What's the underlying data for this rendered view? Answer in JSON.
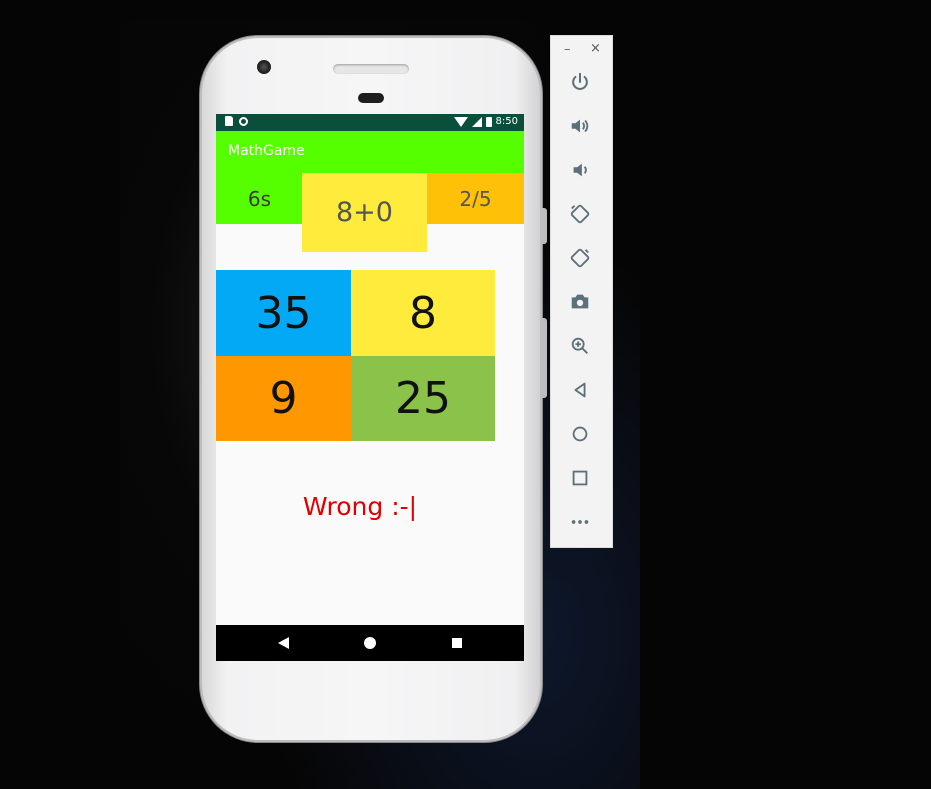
{
  "status_bar": {
    "time": "8:50"
  },
  "app": {
    "title": "MathGame"
  },
  "game": {
    "timer": "6s",
    "question": "8+0",
    "score": "2/5",
    "answers": [
      "35",
      "8",
      "9",
      "25"
    ],
    "result": "Wrong :-|"
  },
  "emulator": {
    "minimize_label": "–",
    "close_label": "×",
    "tools": [
      "power-icon",
      "volume-up-icon",
      "volume-down-icon",
      "rotate-left-icon",
      "rotate-right-icon",
      "camera-icon",
      "zoom-icon",
      "back-icon",
      "home-icon",
      "overview-icon",
      "more-icon"
    ]
  },
  "colors": {
    "app_bar": "#55ff00",
    "timer_bg": "#55ff00",
    "question_bg": "#ffeb3b",
    "score_bg": "#ffc107",
    "answer_bgs": [
      "#03a9f4",
      "#ffeb3b",
      "#ff9800",
      "#8bc34a"
    ],
    "result_text": "#e00000",
    "status_bar": "#0a4f3c"
  }
}
